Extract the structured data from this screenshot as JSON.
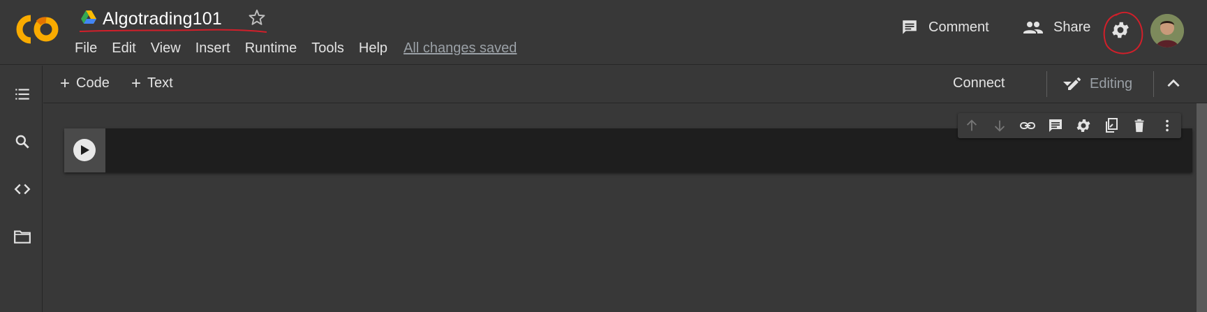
{
  "app": {
    "name": "Google Colab",
    "notebook_title": "Algotrading101",
    "logo_text": "CO"
  },
  "menu": {
    "items": [
      "File",
      "Edit",
      "View",
      "Insert",
      "Runtime",
      "Tools",
      "Help"
    ],
    "save_status": "All changes saved"
  },
  "header": {
    "comment_label": "Comment",
    "share_label": "Share"
  },
  "toolbar": {
    "add_code_label": "Code",
    "add_text_label": "Text",
    "connect_label": "Connect",
    "editing_label": "Editing"
  },
  "icons": {
    "rail": [
      "table-of-contents-icon",
      "search-icon",
      "code-snippets-icon",
      "files-icon"
    ],
    "cell_toolbar": [
      "move-up-icon",
      "move-down-icon",
      "link-icon",
      "comment-icon",
      "settings-icon",
      "mirror-cell-icon",
      "delete-icon",
      "more-icon"
    ]
  },
  "colors": {
    "background": "#383838",
    "cell_background": "#1e1e1e",
    "logo_orange": "#f9ab00",
    "annotation_red": "#d21f2a"
  }
}
